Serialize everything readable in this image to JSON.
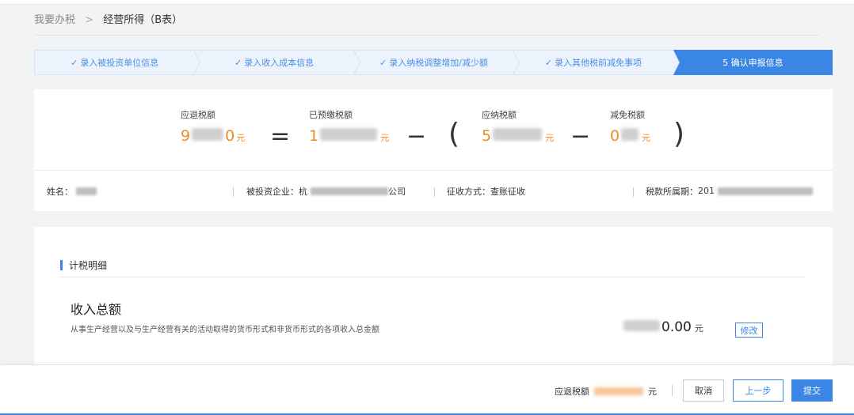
{
  "breadcrumb": {
    "root": "我要办税",
    "separator": ">",
    "current": "经营所得（B表）"
  },
  "steps": [
    {
      "check": "✓",
      "label": "录入被投资单位信息"
    },
    {
      "check": "✓",
      "label": "录入收入成本信息"
    },
    {
      "check": "✓",
      "label": "录入纳税调整增加/减少额"
    },
    {
      "check": "✓",
      "label": "录入其他税前减免事项"
    },
    {
      "check": "",
      "label": "5 确认申报信息"
    }
  ],
  "formula": {
    "refund_label": "应退税额",
    "refund_prefix": "9",
    "refund_suffix": "0",
    "prepaid_label": "已预缴税额",
    "prepaid_prefix": "1",
    "payable_label": "应纳税额",
    "payable_prefix": "5",
    "exempt_label": "减免税额",
    "exempt_prefix": "0",
    "unit": "元",
    "op_equal": "=",
    "op_minus": "−",
    "op_lparen": "(",
    "op_rparen": ")"
  },
  "info": {
    "name_label": "姓名：",
    "enterprise_label": "被投资企业：",
    "enterprise_prefix": "杭",
    "enterprise_suffix": "公司",
    "method_label": "征收方式：",
    "method_value": "查账征收",
    "period_label": "税款所属期：",
    "period_prefix": "201"
  },
  "detail": {
    "section_title": "计税明细",
    "income_title": "收入总额",
    "income_desc": "从事生产经营以及与生产经营有关的活动取得的货币形式和非货币形式的各项收入总金额",
    "income_amount_suffix": "0.00",
    "income_unit": "元",
    "edit_label": "修改"
  },
  "footer": {
    "total_label": "应退税额",
    "total_unit": "元",
    "cancel_label": "取消",
    "prev_label": "上一步",
    "submit_label": "提交"
  },
  "colors": {
    "primary": "#3a86e5",
    "accent_orange": "#f08a24"
  }
}
